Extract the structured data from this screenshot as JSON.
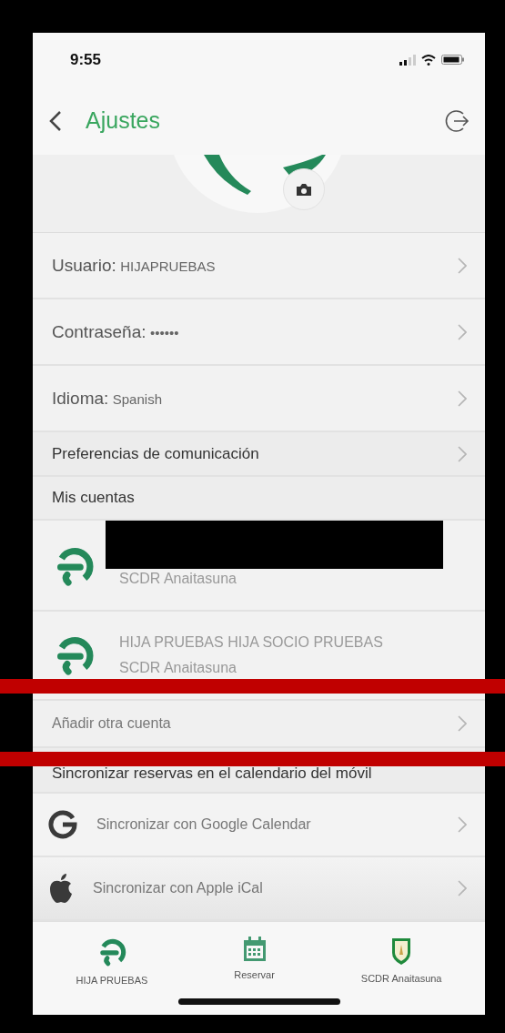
{
  "status_bar": {
    "time": "9:55"
  },
  "nav": {
    "title": "Ajustes"
  },
  "settings": [
    {
      "label": "Usuario:",
      "value": "HIJAPRUEBAS"
    },
    {
      "label": "Contraseña:",
      "value": "••••••"
    },
    {
      "label": "Idioma:",
      "value": "Spanish"
    }
  ],
  "preferences": {
    "label": "Preferencias de comunicación"
  },
  "accounts_section": {
    "title": "Mis cuentas",
    "accounts": [
      {
        "redacted": true,
        "club": "SCDR Anaitasuna"
      },
      {
        "redacted": false,
        "name": "HIJA PRUEBAS HIJA SOCIO PRUEBAS",
        "club": "SCDR Anaitasuna"
      }
    ],
    "add_label": "Añadir otra cuenta"
  },
  "sync_section": {
    "title": "Sincronizar reservas en el calendario del móvil",
    "items": [
      {
        "kind": "google",
        "label": "Sincronizar con Google Calendar"
      },
      {
        "kind": "apple",
        "label": "Sincronizar con Apple iCal"
      }
    ]
  },
  "tab_bar": [
    {
      "kind": "club-logo",
      "label": "HIJA PRUEBAS"
    },
    {
      "kind": "calendar",
      "label": "Reservar"
    },
    {
      "kind": "shield",
      "label": "SCDR Anaitasuna"
    }
  ]
}
